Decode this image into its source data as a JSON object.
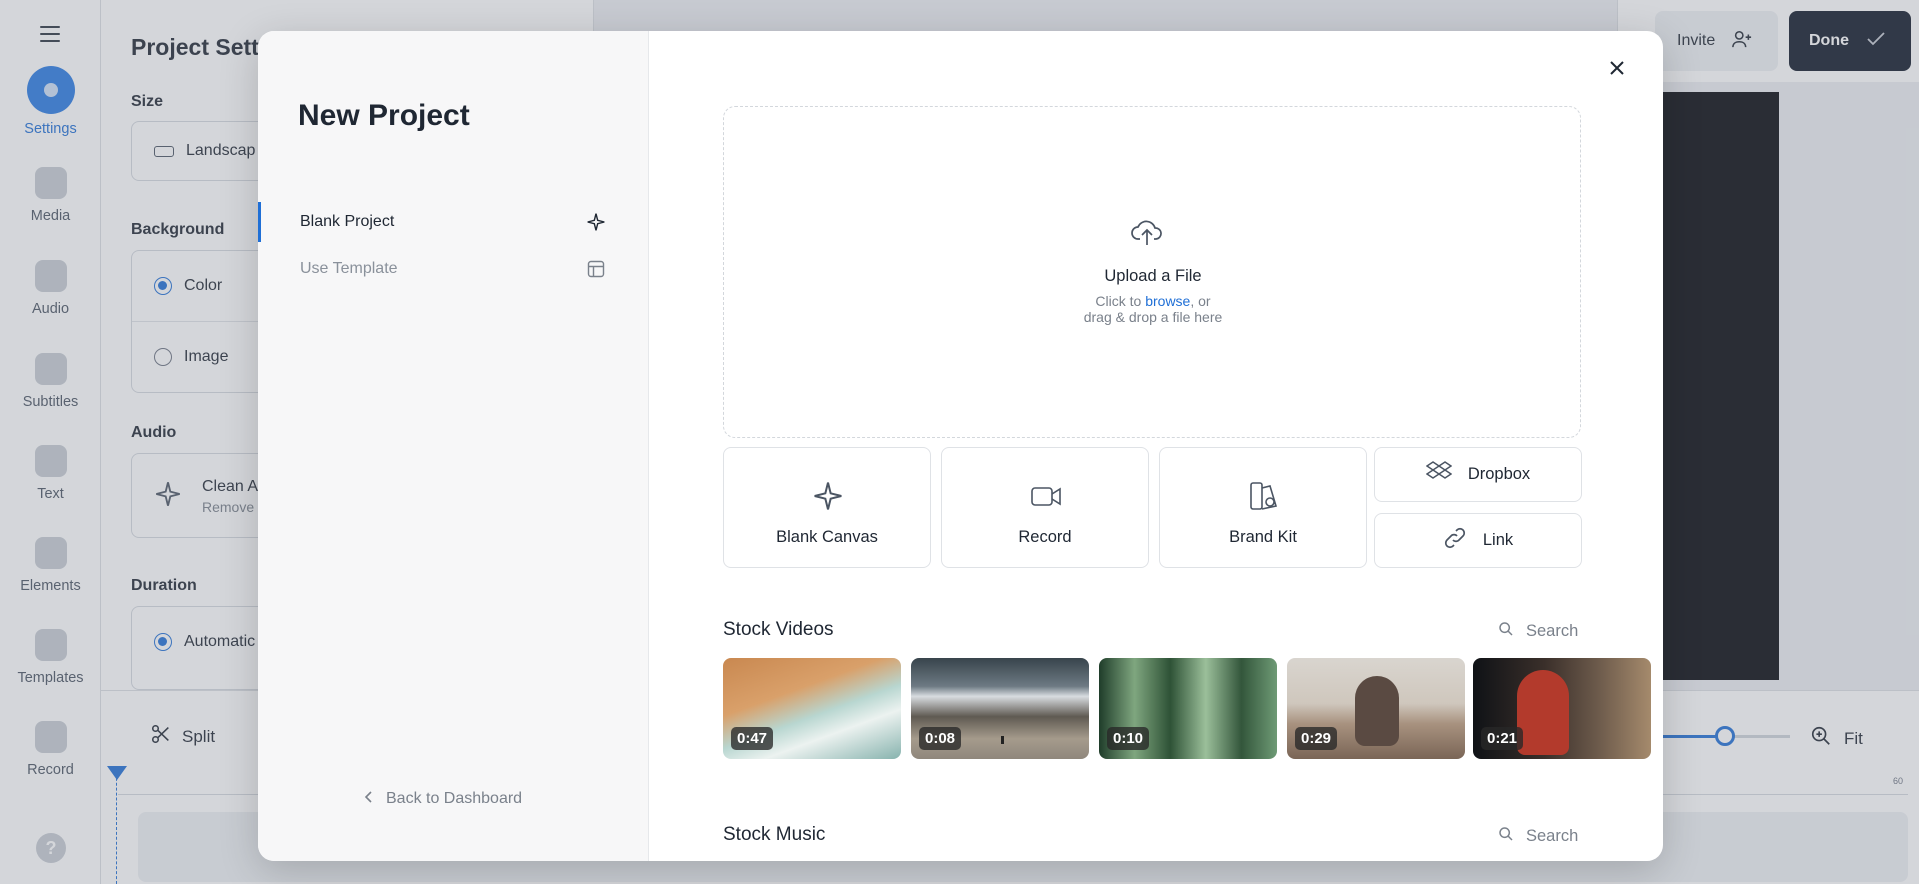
{
  "rail": {
    "items": [
      {
        "label": "Settings"
      },
      {
        "label": "Media"
      },
      {
        "label": "Audio"
      },
      {
        "label": "Subtitles"
      },
      {
        "label": "Text"
      },
      {
        "label": "Elements"
      },
      {
        "label": "Templates"
      },
      {
        "label": "Record"
      }
    ],
    "help": "?"
  },
  "settings": {
    "title": "Project Setti",
    "size_label": "Size",
    "size_value": "Landscap",
    "background_label": "Background",
    "bg_option_color": "Color",
    "bg_option_image": "Image",
    "audio_label": "Audio",
    "audio_title": "Clean A",
    "audio_sub": "Remove",
    "duration_label": "Duration",
    "duration_value": "Automatic"
  },
  "topbar": {
    "invite_label": "Invite",
    "done_label": "Done"
  },
  "timeline": {
    "split_label": "Split",
    "fit_label": "Fit",
    "ruler_end": "60",
    "zoom_fraction": 0.5
  },
  "modal": {
    "title": "New Project",
    "nav": [
      {
        "label": "Blank Project",
        "icon": "sparkle-icon"
      },
      {
        "label": "Use Template",
        "icon": "template-icon"
      }
    ],
    "back_label": "Back to Dashboard",
    "upload": {
      "title": "Upload a File",
      "sub_before": "Click to ",
      "sub_link": "browse",
      "sub_after": ", or",
      "sub_line2": "drag & drop a file here"
    },
    "tiles": {
      "blank_canvas": "Blank Canvas",
      "record": "Record",
      "brand_kit": "Brand Kit",
      "dropbox": "Dropbox",
      "link": "Link"
    },
    "stock_videos": {
      "title": "Stock Videos",
      "search": "Search",
      "items": [
        {
          "duration": "0:47"
        },
        {
          "duration": "0:08"
        },
        {
          "duration": "0:10"
        },
        {
          "duration": "0:29"
        },
        {
          "duration": "0:21"
        }
      ]
    },
    "stock_music": {
      "title": "Stock Music",
      "search": "Search"
    }
  },
  "colors": {
    "accent": "#1f6fd6",
    "dark": "#101828"
  }
}
